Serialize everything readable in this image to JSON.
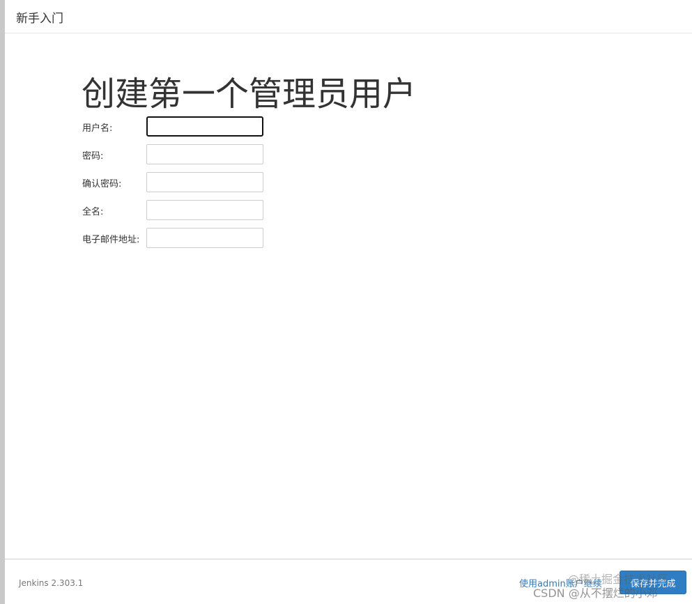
{
  "header": {
    "title": "新手入门"
  },
  "main": {
    "title": "创建第一个管理员用户",
    "fields": [
      {
        "label": "用户名:",
        "value": ""
      },
      {
        "label": "密码:",
        "value": ""
      },
      {
        "label": "确认密码:",
        "value": ""
      },
      {
        "label": "全名:",
        "value": ""
      },
      {
        "label": "电子邮件地址:",
        "value": ""
      }
    ]
  },
  "footer": {
    "version": "Jenkins 2.303.1",
    "continue_label": "使用admin账户继续",
    "save_label": "保存并完成"
  },
  "watermark": {
    "line1": "@稀土掘金技术社区",
    "line2": "CSDN @从不摆烂的小邓"
  },
  "colors": {
    "primary_button": "#2f7ec4",
    "link": "#337ab7",
    "text": "#333333"
  }
}
